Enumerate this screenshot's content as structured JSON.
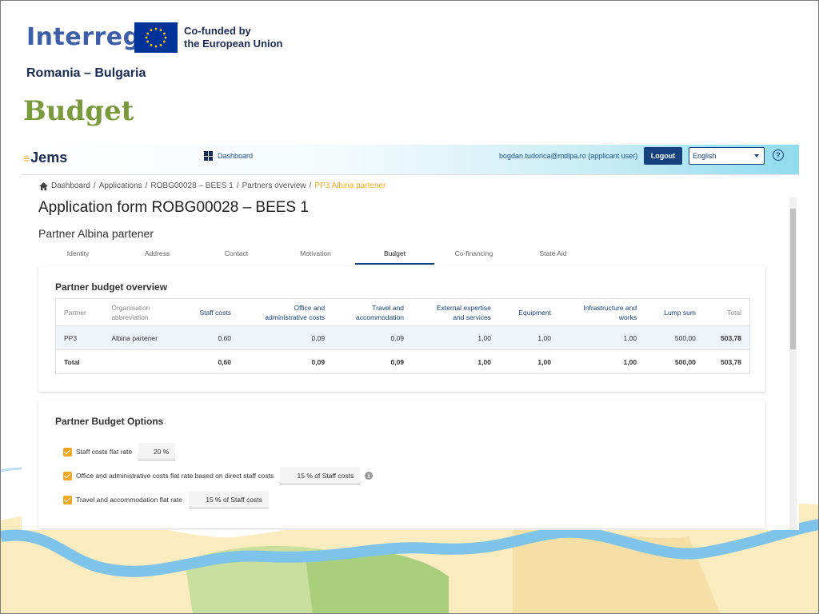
{
  "slide": {
    "logo_text": "Interreg",
    "cofunded_line1": "Co-funded by",
    "cofunded_line2": "the European Union",
    "region": "Romania – Bulgaria",
    "title": "Budget"
  },
  "app": {
    "logo": "Jems",
    "dashboard_label": "Dashboard",
    "user": "bogdan.tudorica@mdlpa.ro (applicant user)",
    "logout_label": "Logout",
    "language": "English",
    "help_icon": "question-circle-icon"
  },
  "breadcrumb": [
    "Dashboard",
    "Applications",
    "ROBG00028 – BEES 1",
    "Partners overview",
    "PP3 Albina partener"
  ],
  "page": {
    "title": "Application form ROBG00028 – BEES 1",
    "partner_title": "Partner Albina partener"
  },
  "tabs": [
    "Identity",
    "Address",
    "Contact",
    "Motivation",
    "Budget",
    "Co-financing",
    "State Aid"
  ],
  "active_tab": "Budget",
  "overview": {
    "title": "Partner budget overview",
    "headers": {
      "partner": "Partner",
      "org_line1": "Organisation",
      "org_line2": "abbreviation",
      "staff": "Staff costs",
      "office_line1": "Office and",
      "office_line2": "administrative costs",
      "travel_line1": "Travel and",
      "travel_line2": "accommodation",
      "external_line1": "External expertise",
      "external_line2": "and services",
      "equipment": "Equipment",
      "infra_line1": "Infrastructure and",
      "infra_line2": "works",
      "lump": "Lump sum",
      "total": "Total"
    },
    "row": {
      "partner": "PP3",
      "org": "Albina partener",
      "staff": "0,60",
      "office": "0,09",
      "travel": "0,09",
      "external": "1,00",
      "equipment": "1,00",
      "infra": "1,00",
      "lump": "500,00",
      "total": "503,78"
    },
    "total_row": {
      "label": "Total",
      "staff": "0,60",
      "office": "0,09",
      "travel": "0,09",
      "external": "1,00",
      "equipment": "1,00",
      "infra": "1,00",
      "lump": "500,00",
      "total": "503,78"
    }
  },
  "options": {
    "title": "Partner Budget Options",
    "staff_label": "Staff costs flat rate",
    "staff_value": "20 %",
    "office_label": "Office and administrative costs flat rate based on direct staff costs",
    "office_value": "15 % of Staff costs",
    "travel_label": "Travel and accommodation flat rate",
    "travel_value": "15 % of Staff costs"
  },
  "colors": {
    "brand_navy": "#15417e",
    "accent_orange": "#f5a623",
    "title_green": "#7a9a3b"
  }
}
